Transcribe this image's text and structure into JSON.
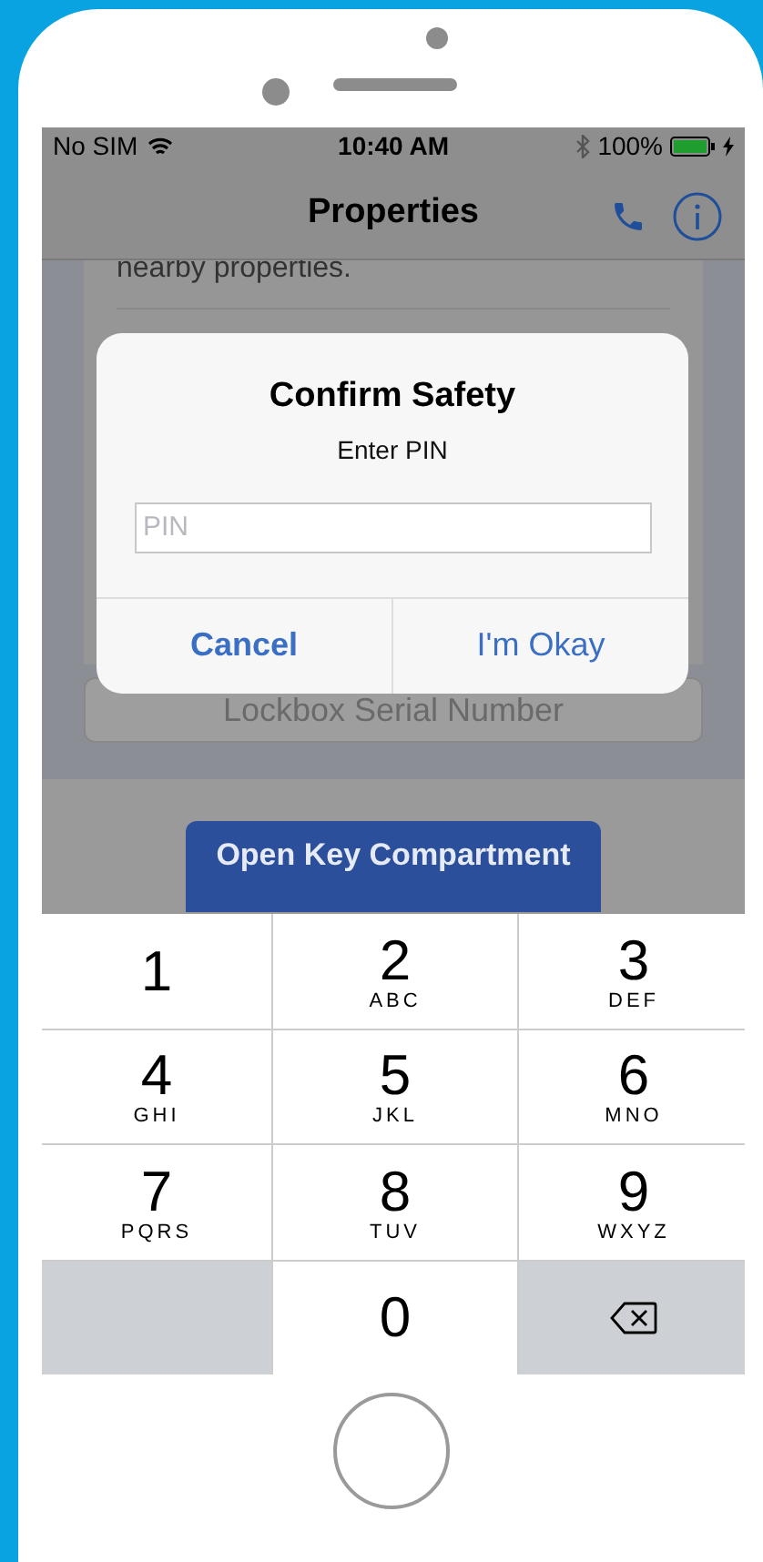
{
  "status_bar": {
    "carrier": "No SIM",
    "time": "10:40 AM",
    "battery": "100%",
    "charging": true
  },
  "nav_bar": {
    "title": "Properties"
  },
  "card": {
    "text": "nearby properties.",
    "field_placeholder": "Lockbox Serial Number"
  },
  "primary_button": {
    "label": "Open Key Compartment"
  },
  "alert": {
    "title": "Confirm Safety",
    "message": "Enter PIN",
    "field": {
      "placeholder": "PIN"
    },
    "buttons": [
      {
        "label": "Cancel",
        "bold": true
      },
      {
        "label": "I'm Okay",
        "bold": false
      }
    ]
  },
  "keypad": {
    "keys": [
      {
        "kind": "digit",
        "digit": "1"
      },
      {
        "kind": "digit",
        "digit": "2",
        "letters": "ABC"
      },
      {
        "kind": "digit",
        "digit": "3",
        "letters": "DEF"
      },
      {
        "kind": "digit",
        "digit": "4",
        "letters": "GHI"
      },
      {
        "kind": "digit",
        "digit": "5",
        "letters": "JKL"
      },
      {
        "kind": "digit",
        "digit": "6",
        "letters": "MNO"
      },
      {
        "kind": "digit",
        "digit": "7",
        "letters": "PQRS"
      },
      {
        "kind": "digit",
        "digit": "8",
        "letters": "TUV"
      },
      {
        "kind": "digit",
        "digit": "9",
        "letters": "WXYZ"
      },
      {
        "kind": "blank"
      },
      {
        "kind": "digit",
        "digit": "0"
      },
      {
        "kind": "delete"
      }
    ]
  }
}
